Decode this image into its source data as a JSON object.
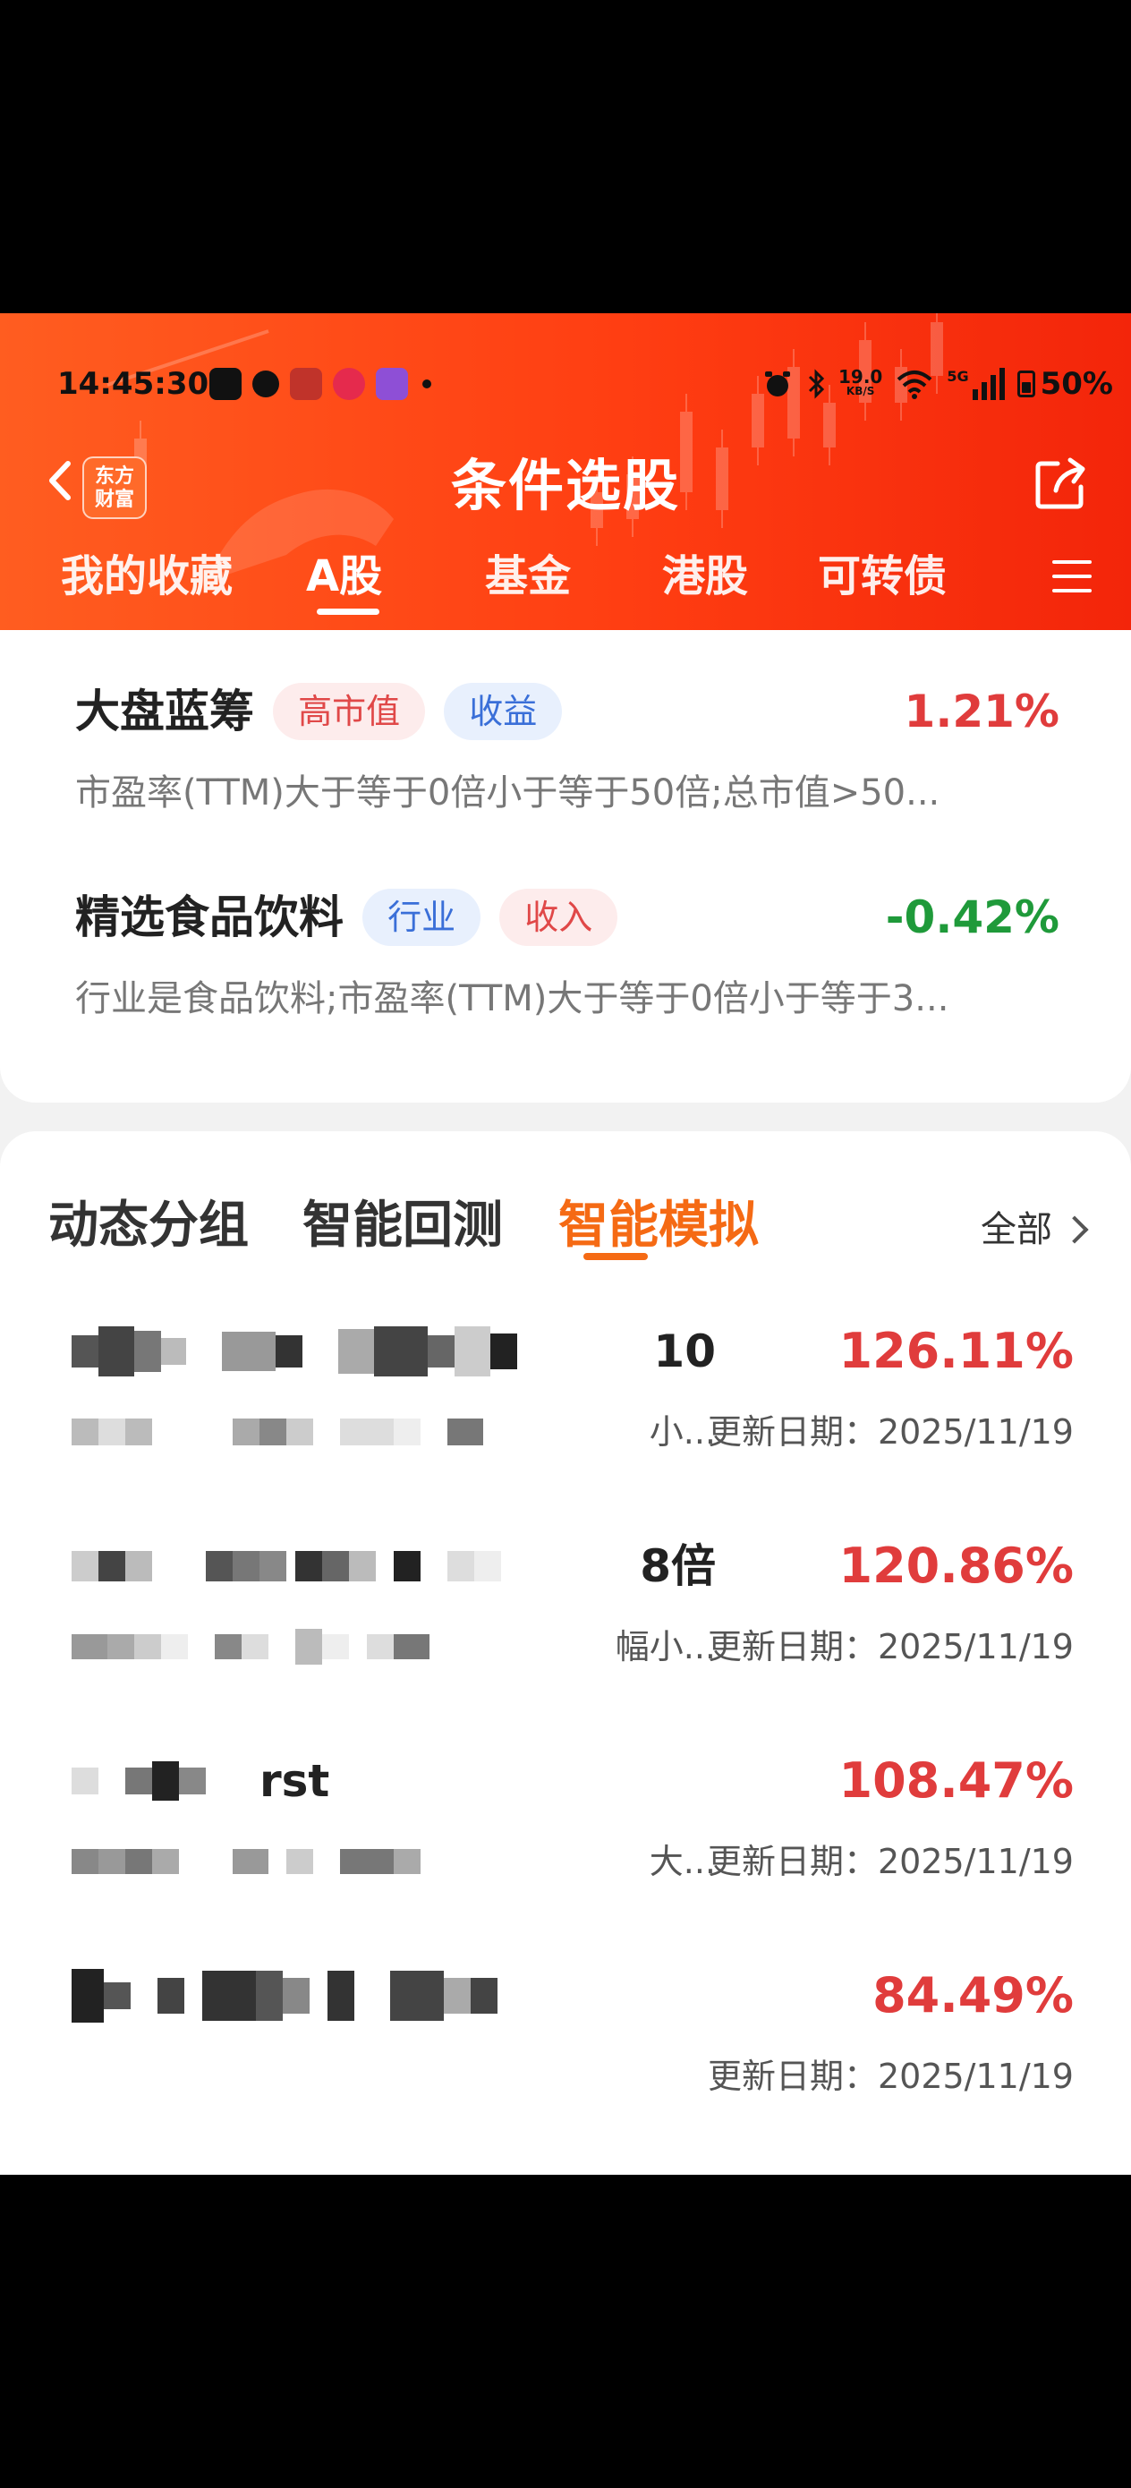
{
  "status_bar": {
    "time": "14:45:30",
    "network_speed_value": "19.0",
    "network_speed_unit": "KB/S",
    "network_type": "5G",
    "battery": "50%"
  },
  "header": {
    "logo_line1": "东方",
    "logo_line2": "财富",
    "title": "条件选股",
    "tabs": [
      "我的收藏",
      "A股",
      "基金",
      "港股",
      "可转债"
    ],
    "active_tab": "A股"
  },
  "strategies": [
    {
      "name": "大盘蓝筹",
      "tags": [
        {
          "text": "高市值",
          "color": "red"
        },
        {
          "text": "收益",
          "color": "blue"
        }
      ],
      "return": "1.21%",
      "desc": "市盈率(TTM)大于等于0倍小于等于50倍;总市值>50..."
    },
    {
      "name": "精选食品饮料",
      "tags": [
        {
          "text": "行业",
          "color": "blue"
        },
        {
          "text": "收入",
          "color": "red"
        }
      ],
      "return": "-0.42%",
      "desc": "行业是食品饮料;市盈率(TTM)大于等于0倍小于等于3..."
    }
  ],
  "section": {
    "tabs": [
      "动态分组",
      "智能回测",
      "智能模拟"
    ],
    "active_tab": "智能模拟",
    "all_label": "全部"
  },
  "simulations": [
    {
      "name_visible": "10",
      "return": "126.11%",
      "desc_visible": "小...",
      "date": "更新日期：2025/11/19"
    },
    {
      "name_visible": "8倍",
      "return": "120.86%",
      "desc_visible": "幅小...",
      "date": "更新日期：2025/11/19"
    },
    {
      "name_visible": "rst",
      "return": "108.47%",
      "desc_visible": "大...",
      "date": "更新日期：2025/11/19"
    },
    {
      "name_visible": "",
      "return": "84.49%",
      "desc_visible": "",
      "date": "更新日期：2025/11/19"
    }
  ],
  "colors": {
    "header_orange": "#ff4a18",
    "accent_orange": "#f56a14",
    "up_red": "#e03c3c",
    "down_green": "#1f9a3a"
  }
}
